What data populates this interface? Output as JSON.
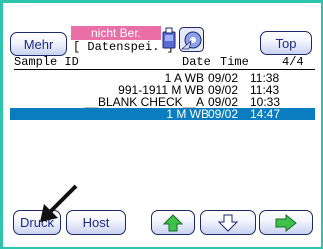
{
  "toolbar": {
    "more_label": "Mehr",
    "top_label": "Top",
    "status_main": "nicht Ber.",
    "status_sub": "[ Datenspei. ]",
    "drive_icon": "usb-drive-icon",
    "tape_icon": "tape-roll-icon"
  },
  "list_header": {
    "sample_id": "Sample ID",
    "date": "Date",
    "time": "Time",
    "page": "4/4"
  },
  "rows": [
    {
      "sample_id": "1 A WB",
      "date": "09/02",
      "time": "11:38",
      "selected": false
    },
    {
      "sample_id": "991-1911 M WB",
      "date": "09/02",
      "time": "11:43",
      "selected": false
    },
    {
      "sample_id": "__BLANK CHECK__A",
      "date": "09/02",
      "time": "10:33",
      "selected": false
    },
    {
      "sample_id": "1 M WB",
      "date": "09/02",
      "time": "14:47",
      "selected": true
    }
  ],
  "bottom_bar": {
    "print_label": "Druck",
    "host_label": "Host",
    "up_icon": "arrow-up-icon",
    "down_icon": "arrow-down-icon",
    "right_icon": "arrow-right-icon"
  },
  "colors": {
    "frame": "#2ec4ad",
    "status_pink": "#e96fa6",
    "selection": "#0a7cc0",
    "arrow_green": "#3ec24a"
  }
}
